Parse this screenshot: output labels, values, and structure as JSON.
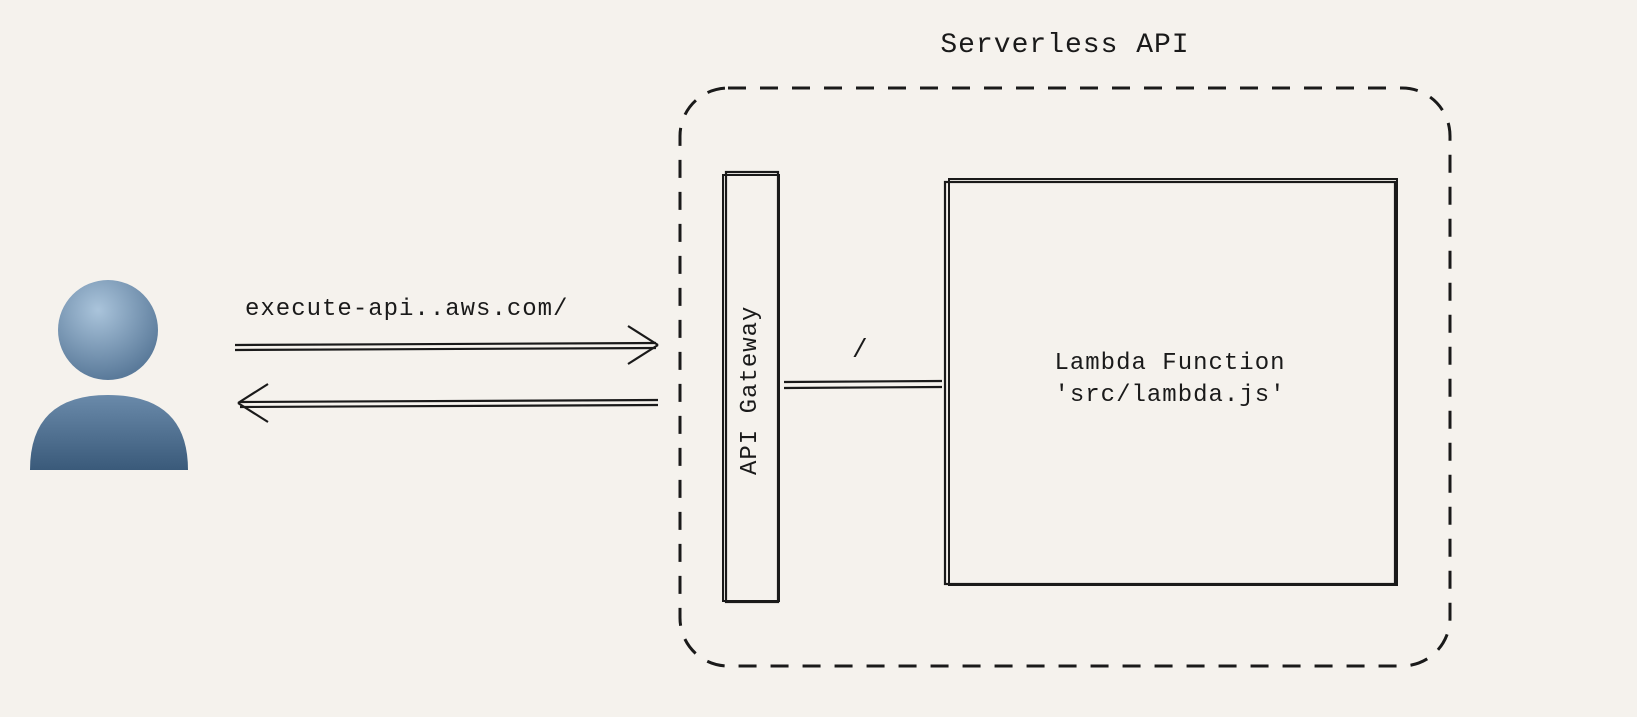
{
  "diagram": {
    "title": "Serverless API",
    "request_label": "execute-api..aws.com/",
    "gateway_label": "API Gateway",
    "route_label": "/",
    "lambda_label_line1": "Lambda Function",
    "lambda_label_line2": "'src/lambda.js'"
  },
  "colors": {
    "background": "#f5f2ed",
    "stroke": "#1a1a1a",
    "user_light": "#8fb0c9",
    "user_dark": "#4a6b8a"
  }
}
